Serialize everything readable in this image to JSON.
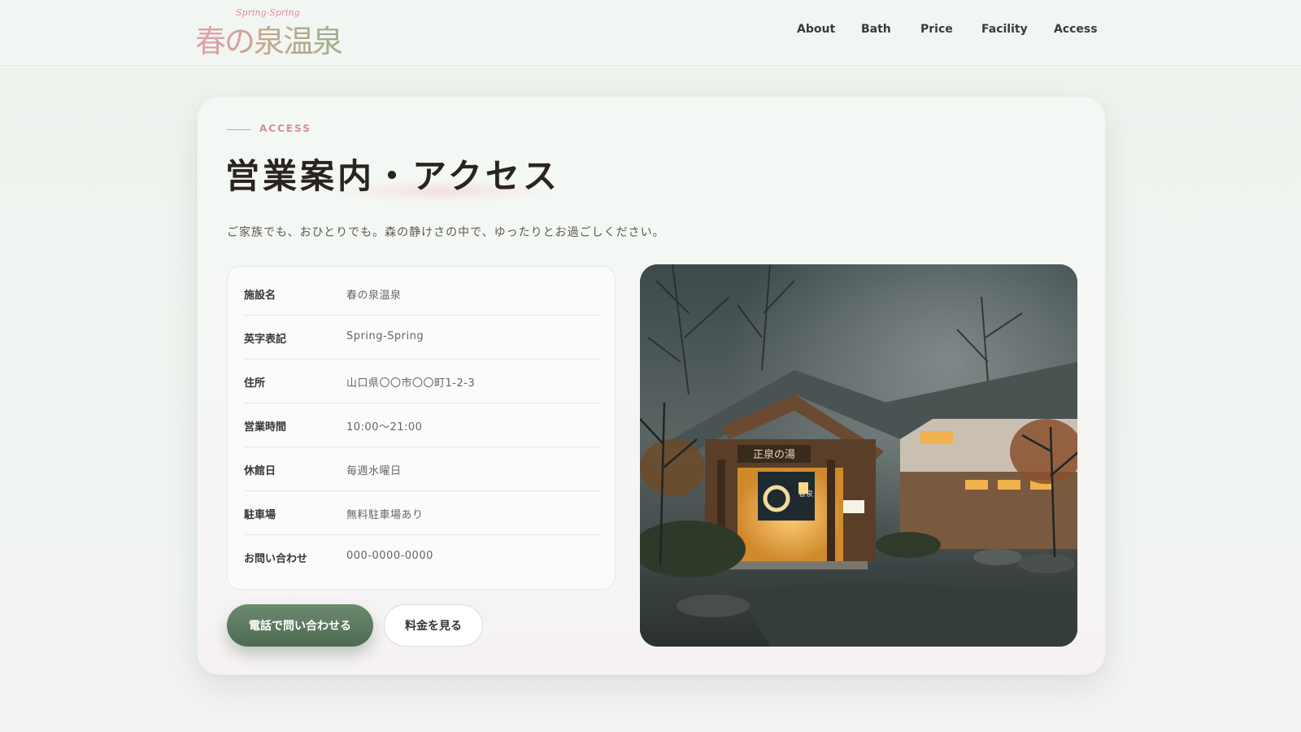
{
  "header": {
    "logo": {
      "subtitle": "Spring-Spring",
      "title": "春の泉温泉"
    },
    "nav": [
      {
        "label": "About"
      },
      {
        "label": "Bath"
      },
      {
        "label": "Price"
      },
      {
        "label": "Facility"
      },
      {
        "label": "Access"
      }
    ]
  },
  "section": {
    "eyebrow": "ACCESS",
    "title": "営業案内・アクセス",
    "lead": "ご家族でも、おひとりでも。森の静けさの中で、ゆったりとお過ごしください。"
  },
  "info": [
    {
      "label": "施設名",
      "value": "春の泉温泉"
    },
    {
      "label": "英字表記",
      "value": "Spring-Spring"
    },
    {
      "label": "住所",
      "value": "山口県〇〇市〇〇町1-2-3"
    },
    {
      "label": "営業時間",
      "value": "10:00〜21:00"
    },
    {
      "label": "休館日",
      "value": "毎週水曜日"
    },
    {
      "label": "駐車場",
      "value": "無料駐車場あり"
    },
    {
      "label": "お問い合わせ",
      "value": "000-0000-0000"
    }
  ],
  "buttons": {
    "call": "電話で問い合わせる",
    "price": "料金を見る"
  },
  "photo": {
    "signboard": "正泉の湯",
    "noren": "春泉"
  },
  "colors": {
    "accent_green": "#5a7a5f",
    "accent_pink": "#d98b98",
    "text_dark": "#2a2421"
  }
}
